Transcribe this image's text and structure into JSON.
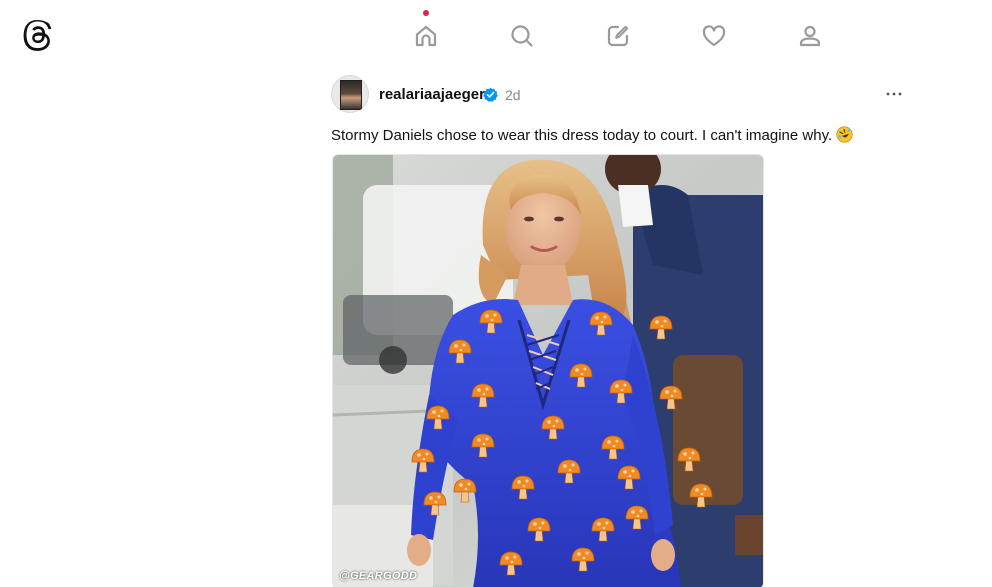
{
  "app": {
    "logo_icon": "threads-logo-icon"
  },
  "nav": {
    "items": [
      {
        "name": "home",
        "icon": "home-icon",
        "active": true,
        "has_notification": true
      },
      {
        "name": "search",
        "icon": "search-icon",
        "active": false
      },
      {
        "name": "create",
        "icon": "compose-icon",
        "active": false
      },
      {
        "name": "activity",
        "icon": "heart-icon",
        "active": false
      },
      {
        "name": "profile",
        "icon": "person-icon",
        "active": false
      }
    ]
  },
  "post": {
    "username": "realariaajaeger",
    "verified": true,
    "timestamp": "2d",
    "text": "Stormy Daniels chose to wear this dress today to court. I can't imagine why.",
    "emoji_icon": "rolling-on-floor-laughing-emoji",
    "image": {
      "watermark": "@GEARGODD"
    }
  },
  "colors": {
    "notification_dot": "#d7264a",
    "verified_badge": "#0095f6",
    "dress_blue": "#2f3fd0",
    "mushroom_orange": "#f08a24"
  }
}
